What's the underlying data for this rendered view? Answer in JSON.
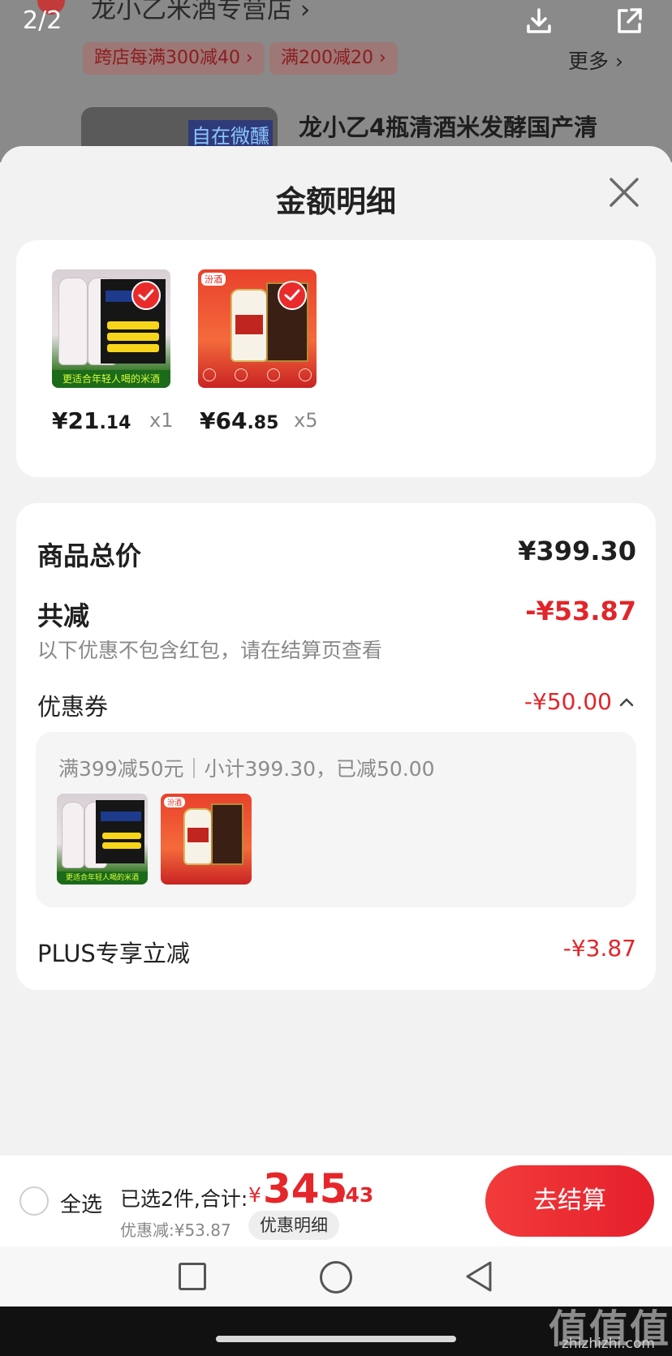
{
  "background": {
    "page_indicator": "2/2",
    "store_name": "龙小乙米酒专营店 ›",
    "promo_tags": [
      "跨店每满300减40 ›",
      "满200减20 ›"
    ],
    "more": "更多 ›",
    "product_title": "龙小乙4瓶清酒米发酵国产清",
    "thumb_tag": "自在微醺"
  },
  "sheet": {
    "title": "金额明细",
    "items": [
      {
        "price_int": "¥21",
        "price_dec": ".14",
        "qty": "x1",
        "band": "更适合年轻人喝的米酒"
      },
      {
        "price_int": "¥64",
        "price_dec": ".85",
        "qty": "x5",
        "tag": "汾酒"
      }
    ],
    "total_label": "商品总价",
    "total_value": "¥399.30",
    "reduce_label": "共减",
    "reduce_value": "-¥53.87",
    "reduce_note": "以下优惠不包含红包，请在结算页查看",
    "coupon_label": "优惠券",
    "coupon_value": "-¥50.00",
    "coupon_line": "满399减50元｜小计399.30，已减50.00",
    "plus_label": "PLUS专享立减",
    "plus_value": "-¥3.87"
  },
  "bottom": {
    "select_all": "全选",
    "summary": "已选2件,合计:",
    "yen": "¥",
    "total_big": "345",
    "total_cents": ".43",
    "discount": "优惠减:¥53.87",
    "detail_button": "优惠明细",
    "checkout": "去结算"
  },
  "watermark": {
    "main": "值值值",
    "sub": "zhizhizhi.com"
  },
  "colors": {
    "accent": "#e5262b",
    "sheet_bg": "#f2f2f2"
  }
}
